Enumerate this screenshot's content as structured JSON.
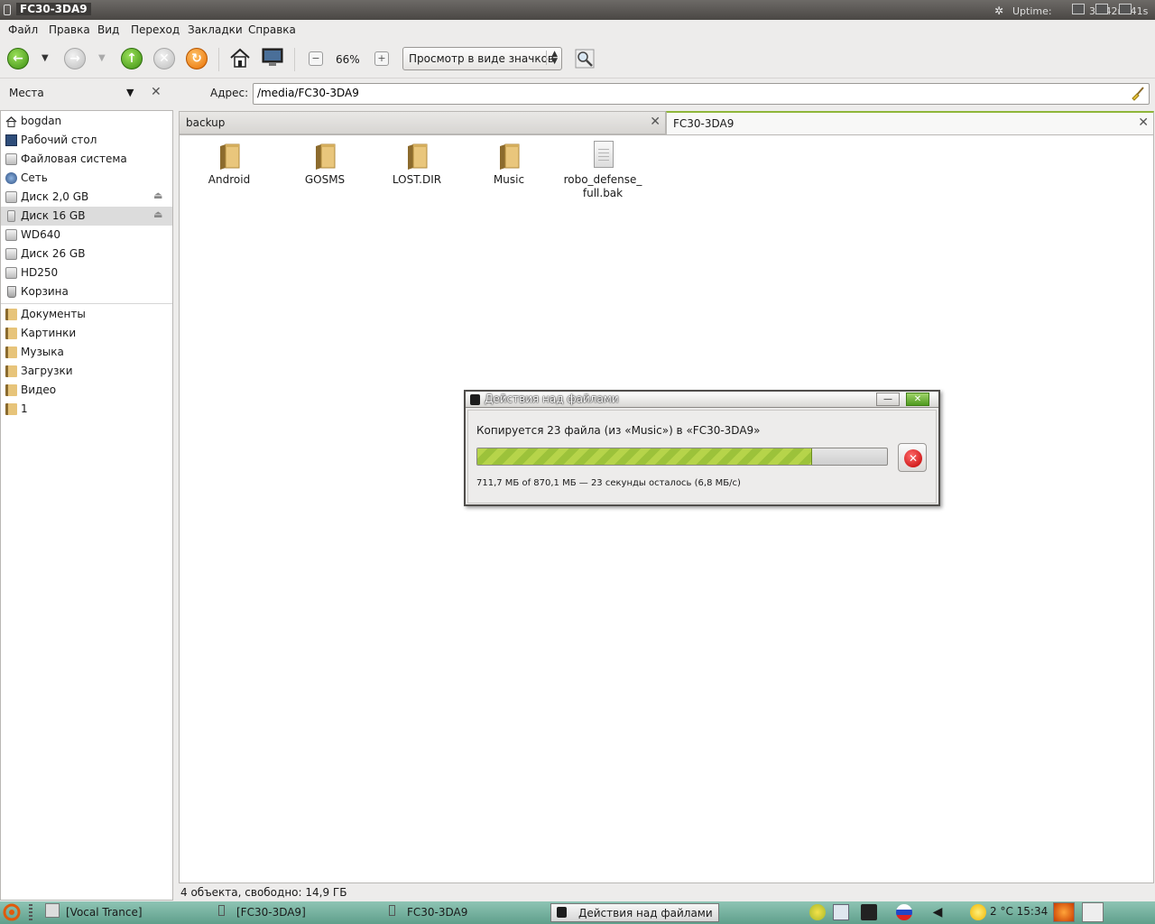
{
  "window": {
    "title": "FC30-3DA9",
    "uptime_label": "Uptime:",
    "uptime_value": "3h 42m 41s"
  },
  "menu": [
    "Файл",
    "Правка",
    "Вид",
    "Переход",
    "Закладки",
    "Справка"
  ],
  "toolbar": {
    "zoom": "66%",
    "view_mode": "Просмотр в виде значков"
  },
  "places": {
    "title": "Места"
  },
  "address": {
    "label": "Адрес:",
    "value": "/media/FC30-3DA9"
  },
  "sidebar": {
    "devices": [
      {
        "label": "bogdan",
        "icon": "home-icon"
      },
      {
        "label": "Рабочий стол",
        "icon": "desktop-icon"
      },
      {
        "label": "Файловая система",
        "icon": "drive-icon"
      },
      {
        "label": "Сеть",
        "icon": "network-icon"
      },
      {
        "label": "Диск 2,0 GB",
        "icon": "drive-icon",
        "eject": true
      },
      {
        "label": "Диск 16 GB",
        "icon": "usb-drive-icon",
        "eject": true,
        "selected": true
      },
      {
        "label": "WD640",
        "icon": "drive-icon"
      },
      {
        "label": "Диск 26 GB",
        "icon": "drive-icon"
      },
      {
        "label": "HD250",
        "icon": "drive-icon"
      },
      {
        "label": "Корзина",
        "icon": "trash-icon"
      }
    ],
    "bookmarks": [
      {
        "label": "Документы",
        "icon": "folder-icon"
      },
      {
        "label": "Картинки",
        "icon": "folder-icon"
      },
      {
        "label": "Музыка",
        "icon": "folder-icon"
      },
      {
        "label": "Загрузки",
        "icon": "folder-icon"
      },
      {
        "label": "Видео",
        "icon": "folder-icon"
      },
      {
        "label": "1",
        "icon": "folder-icon"
      }
    ]
  },
  "tabs": [
    {
      "label": "backup",
      "active": false
    },
    {
      "label": "FC30-3DA9",
      "active": true
    }
  ],
  "files": [
    {
      "name": "Android",
      "type": "folder"
    },
    {
      "name": "GOSMS",
      "type": "folder"
    },
    {
      "name": "LOST.DIR",
      "type": "folder"
    },
    {
      "name": "Music",
      "type": "folder"
    },
    {
      "name_line1": "robo_defense_",
      "name_line2": "full.bak",
      "type": "file"
    }
  ],
  "status": "4 объекта, свободно: 14,9 ГБ",
  "dialog": {
    "title": "Действия над файлами",
    "message": "Копируется 23 файла (из «Music») в «FC30-3DA9»",
    "progress_fraction": 0.818,
    "detail": "711,7 МБ of 870,1 МБ — 23 секунды осталось (6,8 МБ/с)"
  },
  "taskbar": {
    "tasks": [
      "[Vocal Trance]",
      "[FC30-3DA9]",
      "FC30-3DA9",
      "Действия над файлами"
    ],
    "weather": "2 °C",
    "clock": "15:34"
  }
}
